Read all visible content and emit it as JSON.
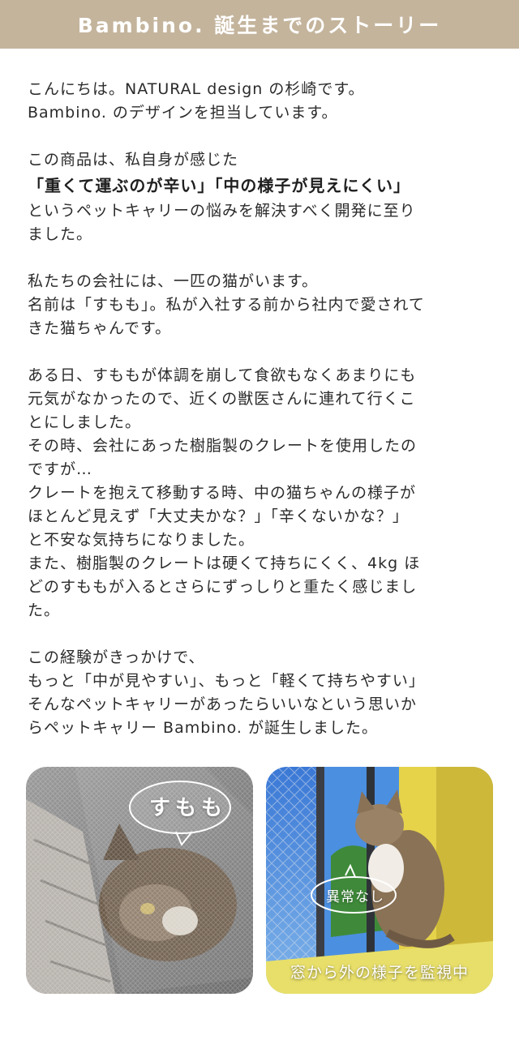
{
  "header": {
    "title": "Bambino. 誕生までのストーリー",
    "bg_color": "#c4b49c"
  },
  "story": {
    "paragraphs": [
      {
        "lines": [
          "こんにちは。NATURAL design の杉崎です。",
          "Bambino. のデザインを担当しています。"
        ]
      },
      {
        "lines": [
          "この商品は、私自身が感じた"
        ]
      },
      {
        "lines": [
          "「重くて運ぶのが辛い」「中の様子が見えにくい」"
        ]
      },
      {
        "lines": [
          "というペットキャリーの悩みを解決すべく開発に至り",
          "ました。"
        ]
      },
      {
        "lines": [
          "私たちの会社には、一匹の猫がいます。",
          "名前は「すもも」。私が入社する前から社内で愛されて",
          "きた猫ちゃんです。"
        ]
      },
      {
        "lines": [
          "ある日、すももが体調を崩して食欲もなくあまりにも",
          "元気がなかったので、近くの獣医さんに連れて行くこ",
          "とにしました。",
          "その時、会社にあった樹脂製のクレートを使用したの",
          "ですが…",
          "クレートを抱えて移動する時、中の猫ちゃんの様子が",
          "ほとんど見えず「大丈夫かな？」「辛くないかな？」",
          "と不安な気持ちになりました。",
          "また、樹脂製のクレートは硬くて持ちにくく、4kg ほ",
          "どのすももが入るとさらにずっしりと重たく感じまし",
          "た。"
        ]
      },
      {
        "lines": [
          "この経験がきっかけで、",
          "もっと「中が見やすい」、もっと「軽くて持ちやすい」",
          "そんなペットキャリーがあったらいいなという思いか",
          "らペットキャリー Bambino. が誕生しました。"
        ]
      }
    ]
  },
  "photos": {
    "left": {
      "bubble_text": "すもも"
    },
    "right": {
      "bubble_text": "異常なし",
      "caption": "窓から外の様子を監視中"
    }
  }
}
